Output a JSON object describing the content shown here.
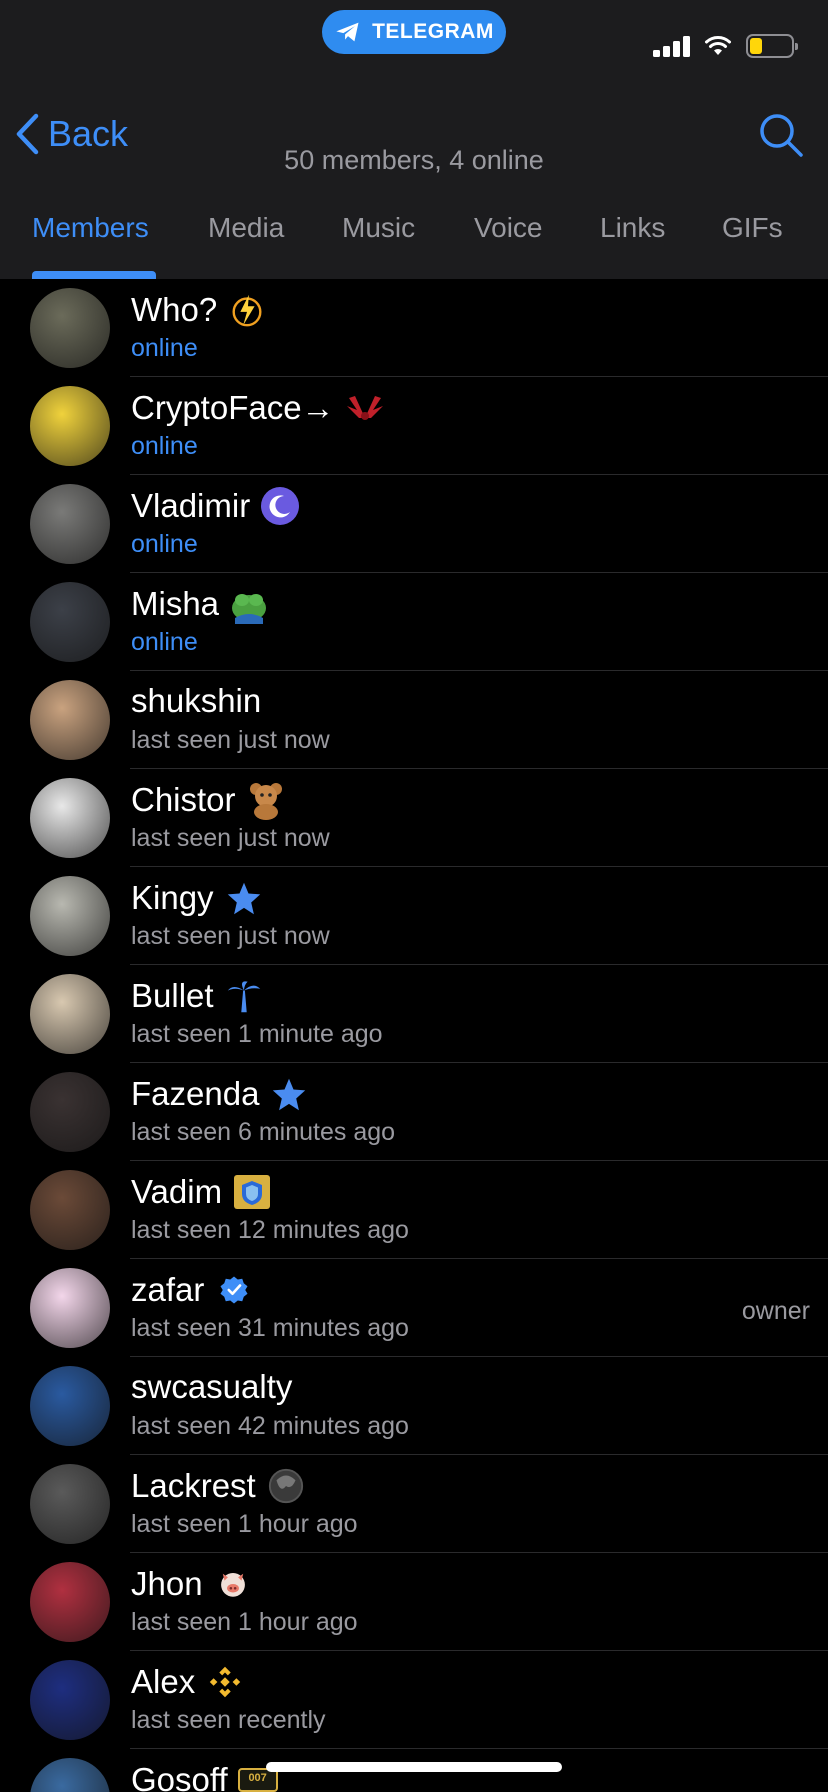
{
  "status_bar": {
    "pill_label": "TELEGRAM",
    "accent": "#2f8cf0"
  },
  "nav": {
    "back_label": "Back",
    "subtitle": "50 members, 4 online",
    "search_icon": "search-icon"
  },
  "tabs": [
    {
      "label": "Members",
      "active": true
    },
    {
      "label": "Media"
    },
    {
      "label": "Music"
    },
    {
      "label": "Voice"
    },
    {
      "label": "Links"
    },
    {
      "label": "GIFs"
    }
  ],
  "members": [
    {
      "name": "Who?",
      "status": "online",
      "online": true,
      "badge": "lightning-icon",
      "avatar_color": "#6b6b5a"
    },
    {
      "name": "CryptoFace→",
      "status": "online",
      "online": true,
      "badge": "red-wings-icon",
      "avatar_color": "#f0d23c"
    },
    {
      "name": "Vladimir",
      "status": "online",
      "online": true,
      "badge": "moon-icon",
      "avatar_color": "#7a7a78"
    },
    {
      "name": "Misha",
      "status": "online",
      "online": true,
      "badge": "pepe-frog-icon",
      "avatar_color": "#3c4048"
    },
    {
      "name": "shukshin",
      "status": "last seen just now",
      "online": false,
      "badge": "",
      "avatar_color": "#c9a27f"
    },
    {
      "name": "Chistor",
      "status": "last seen just now",
      "online": false,
      "badge": "teddy-bear-icon",
      "avatar_color": "#e8e8e8"
    },
    {
      "name": "Kingy",
      "status": "last seen just now",
      "online": false,
      "badge": "star-icon",
      "avatar_color": "#b8b8b0"
    },
    {
      "name": "Bullet",
      "status": "last seen 1 minute ago",
      "online": false,
      "badge": "palm-tree-icon",
      "avatar_color": "#d8c8b0"
    },
    {
      "name": "Fazenda",
      "status": "last seen 6 minutes ago",
      "online": false,
      "badge": "star-icon",
      "avatar_color": "#3a3232"
    },
    {
      "name": "Vadim",
      "status": "last seen 12 minutes ago",
      "online": false,
      "badge": "shield-badge-icon",
      "avatar_color": "#6b4a38"
    },
    {
      "name": "zafar",
      "status": "last seen 31 minutes ago",
      "online": false,
      "badge": "verified-icon",
      "role": "owner",
      "avatar_color": "#f3d6ea"
    },
    {
      "name": "swcasualty",
      "status": "last seen 42 minutes ago",
      "online": false,
      "badge": "",
      "avatar_color": "#2a5aa0"
    },
    {
      "name": "Lackrest",
      "status": "last seen 1 hour ago",
      "online": false,
      "badge": "dark-orb-icon",
      "avatar_color": "#5a5a5a"
    },
    {
      "name": "Jhon",
      "status": "last seen 1 hour ago",
      "online": false,
      "badge": "pig-icon",
      "avatar_color": "#b03040"
    },
    {
      "name": "Alex",
      "status": "last seen recently",
      "online": false,
      "badge": "binance-icon",
      "avatar_color": "#1e2e80"
    },
    {
      "name": "Gosoff",
      "status": "",
      "online": false,
      "badge": "007-plate-icon",
      "badge_text": "007",
      "avatar_color": "#3a6aa0"
    }
  ]
}
